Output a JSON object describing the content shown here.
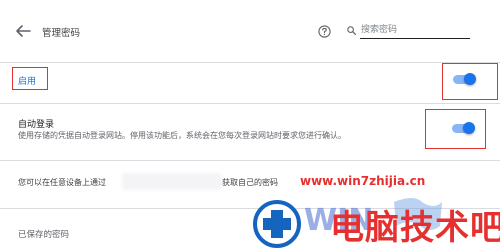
{
  "header": {
    "title": "管理密码",
    "search_placeholder": "搜索密码"
  },
  "settings": {
    "enable_label": "启用",
    "enable_toggle_on": true,
    "auto_signin": {
      "title": "自动登录",
      "description": "使用存储的凭据自动登录网站。停用该功能后，系统会在您每次登录网站时要求您进行确认。",
      "toggle_on": true
    },
    "manage_text_before": "您可以在任意设备上通过",
    "manage_text_after": "获取自己的密码",
    "saved_passwords_title": "已保存的密码"
  },
  "watermark": {
    "url": "www.win7zhijia.cn",
    "logo_text": "电脑技术吧"
  },
  "colors": {
    "accent": "#1a73e8",
    "highlight_box": "#e5302f",
    "watermark": "#e5302f"
  }
}
